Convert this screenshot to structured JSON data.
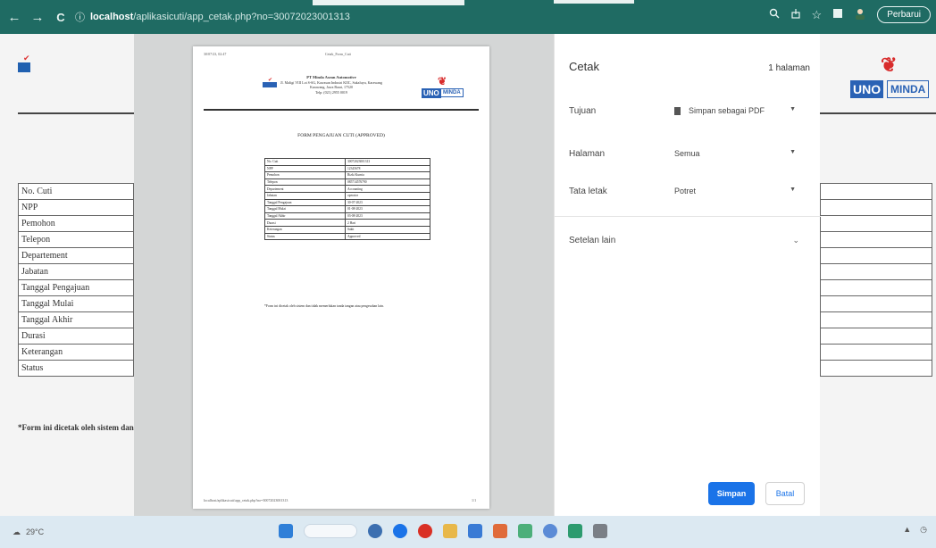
{
  "browser": {
    "back": "←",
    "forward": "→",
    "reload": "C",
    "info_icon": "ⓘ",
    "url_host": "localhost",
    "url_path": "/aplikasicuti/app_cetak.php?no=30072023001313",
    "update_label": "Perbarui"
  },
  "background_page": {
    "rows": [
      "No. Cuti",
      "NPP",
      "Pemohon",
      "Telepon",
      "Departement",
      "Jabatan",
      "Tanggal Pengajuan",
      "Tanggal Mulai",
      "Tanggal Akhir",
      "Durasi",
      "Keterangan",
      "Status"
    ],
    "note": "*Form ini dicetak oleh sistem dan"
  },
  "preview_sheet": {
    "header_left": "30/07/23, 02:47",
    "header_center": "Cetak_Form_Cuti",
    "company_name": "PT Minda Asean Automotive",
    "company_address": "Jl. Maligi VIII Lot S-6G, Kawasan Industri KIIC, Sukaluyu, Karawang",
    "company_city": "Karawang, Jawa Barat, 17520",
    "company_phone": "Telp: (021) 2955 0019",
    "logo_small": "UNO MINDA",
    "logo_u": "UNO",
    "logo_m": "MINDA",
    "title": "FORM PENGAJUAN CUTI (APPROVED)",
    "rows": [
      {
        "label": "No. Cuti",
        "value": "30072023001313"
      },
      {
        "label": "NPP",
        "value": "12345678"
      },
      {
        "label": "Pemohon",
        "value": "Rizki Kurnia"
      },
      {
        "label": "Telepon",
        "value": "085714576790"
      },
      {
        "label": "Departement",
        "value": "Accounting"
      },
      {
        "label": "Jabatan",
        "value": "operator"
      },
      {
        "label": "Tanggal Pengajuan",
        "value": "30-07-2023"
      },
      {
        "label": "Tanggal Mulai",
        "value": "01-08-2023"
      },
      {
        "label": "Tanggal Akhir",
        "value": "03-08-2023"
      },
      {
        "label": "Durasi",
        "value": "2 Hari"
      },
      {
        "label": "Keterangan",
        "value": "Sakit"
      },
      {
        "label": "Status",
        "value": "Approved"
      }
    ],
    "note": "*Form ini dicetak oleh sistem dan tidak memerlukan tanda tangan atau pengesahan lain.",
    "footer_left": "localhost/aplikasicuti/app_cetak.php?no=30072023001313",
    "footer_right": "1/1"
  },
  "print_dialog": {
    "title": "Cetak",
    "page_count": "1 halaman",
    "destination_label": "Tujuan",
    "destination_value": "Simpan sebagai PDF",
    "pages_label": "Halaman",
    "pages_value": "Semua",
    "layout_label": "Tata letak",
    "layout_value": "Potret",
    "more_settings": "Setelan lain",
    "save_button": "Simpan",
    "cancel_button": "Batal"
  },
  "taskbar": {
    "weather": "29°C"
  },
  "colors": {
    "browser_bar": "#1f6b63",
    "accent_blue": "#1a73e8",
    "logo_blue": "#2a62b5",
    "logo_red": "#d82b2b"
  }
}
